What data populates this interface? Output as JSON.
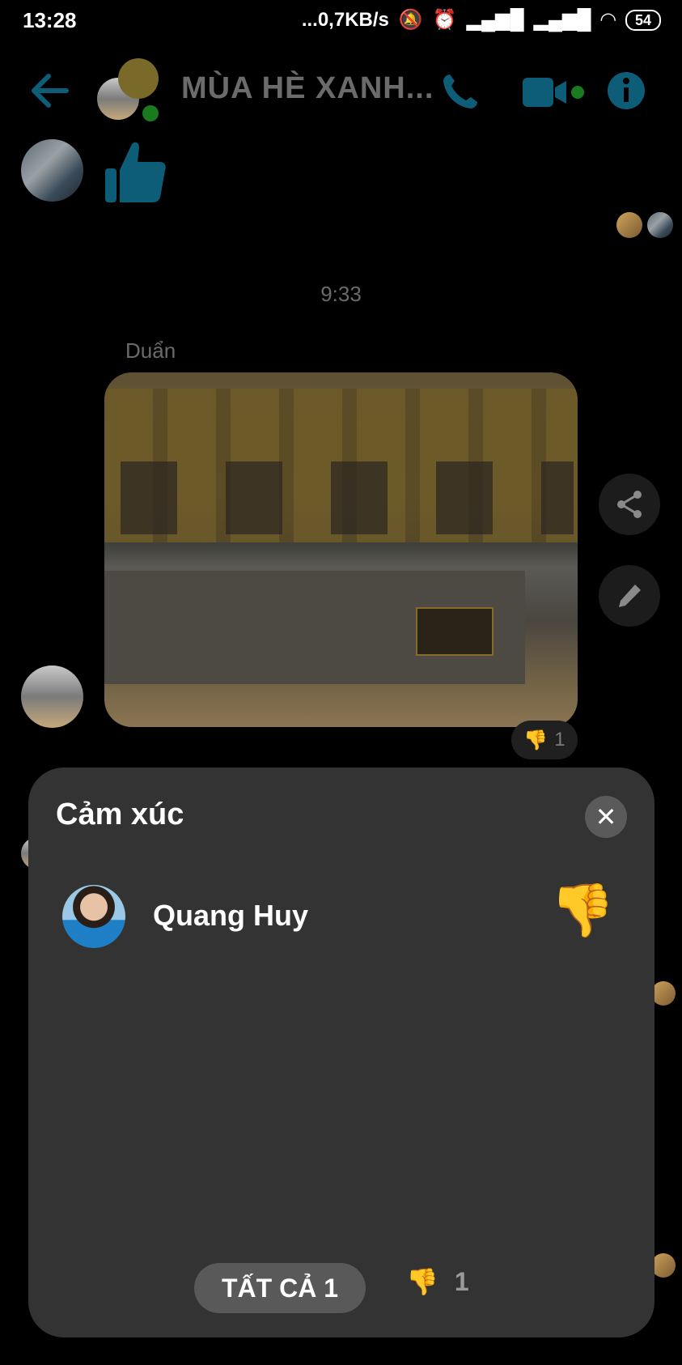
{
  "status_bar": {
    "time": "13:28",
    "network_speed": "...0,7KB/s",
    "battery": "54"
  },
  "header": {
    "title": "MÙA HÈ XANH...",
    "back_icon": "arrow-left-icon",
    "call_icon": "phone-icon",
    "video_icon": "video-camera-icon",
    "info_icon": "info-icon"
  },
  "chat": {
    "timestamp": "9:33",
    "sender_name": "Duẩn",
    "reaction_count": "1"
  },
  "reaction_sheet": {
    "title": "Cảm xúc",
    "entries": [
      {
        "name": "Quang Huy",
        "emoji": "👎"
      }
    ],
    "tabs": [
      {
        "label": "TẤT CẢ 1"
      },
      {
        "emoji": "👎",
        "count": "1"
      }
    ]
  },
  "colors": {
    "accent": "#0e5d78",
    "sheet_bg": "#333333",
    "online_dot": "#1a7a20"
  }
}
